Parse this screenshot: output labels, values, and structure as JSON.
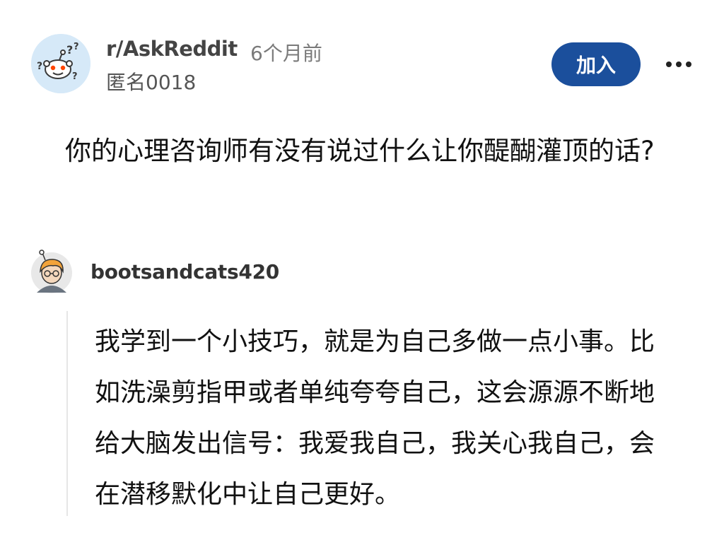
{
  "post": {
    "subreddit": "r/AskReddit",
    "time_ago": "6个月前",
    "author": "匿名0018",
    "join_label": "加入",
    "more_icon": "more-horizontal-icon",
    "title": "你的心理咨询师有没有说过什么让你醍醐灌顶的话?"
  },
  "comment": {
    "author": "bootsandcats420",
    "body": "我学到一个小技巧，就是为自己多做一点小事。比如洗澡剪指甲或者单纯夸夸自己，这会源源不断地给大脑发出信号：我爱我自己，我关心我自己，会在潜移默化中让自己更好。"
  },
  "colors": {
    "join_button_bg": "#1b4f9c",
    "subreddit_avatar_bg": "#d6e9f8"
  }
}
